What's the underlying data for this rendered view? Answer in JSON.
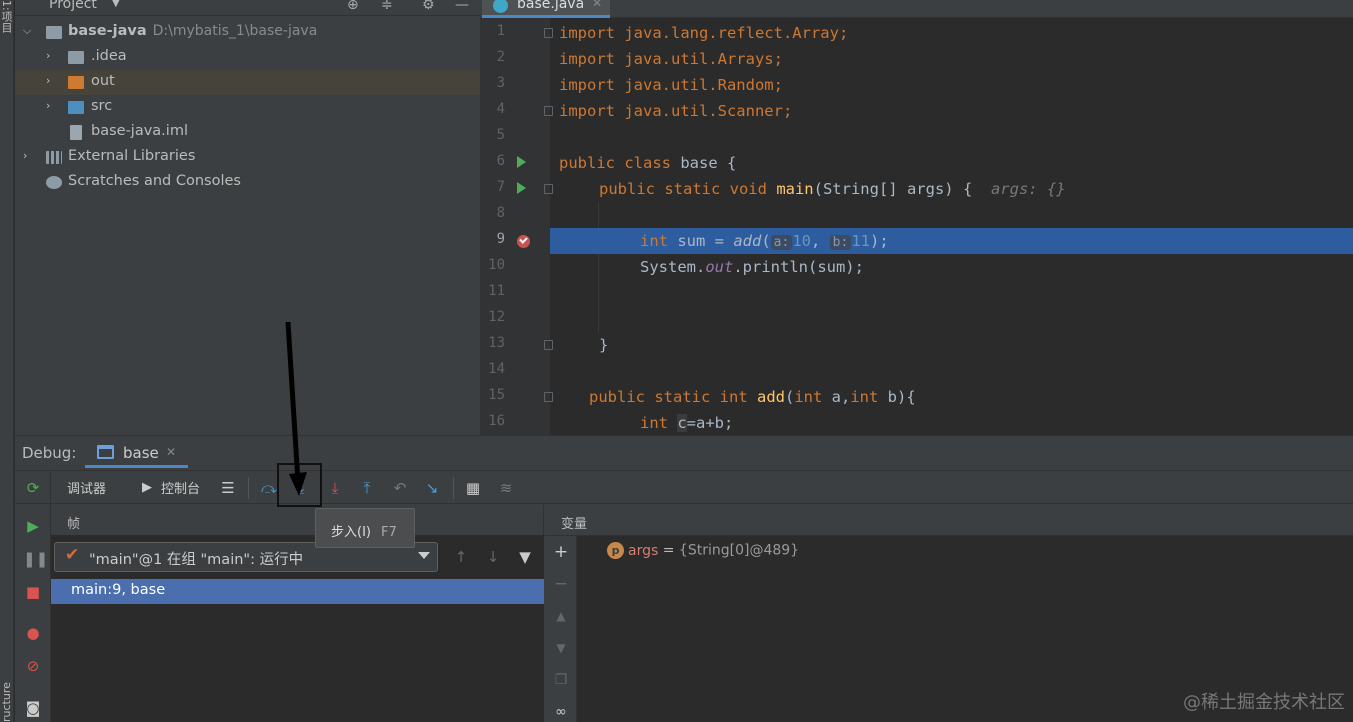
{
  "project_panel": {
    "title": "Project",
    "tree": [
      {
        "label": "base-java",
        "path": "D:\\mybatis_1\\base-java",
        "icon": "module-folder-icon",
        "expanded": true
      },
      {
        "label": ".idea",
        "icon": "folder-icon"
      },
      {
        "label": "out",
        "icon": "folder-orange-icon"
      },
      {
        "label": "src",
        "icon": "folder-blue-icon"
      },
      {
        "label": "base-java.iml",
        "icon": "iml-file-icon"
      },
      {
        "label": "External Libraries",
        "icon": "libraries-icon"
      },
      {
        "label": "Scratches and Consoles",
        "icon": "scratches-icon"
      }
    ]
  },
  "left_strip": {
    "top_label": "1:项目",
    "bottom_label": "ructure"
  },
  "editor": {
    "tab": "base.java",
    "lines": [
      "1",
      "2",
      "3",
      "4",
      "5",
      "6",
      "7",
      "8",
      "9",
      "10",
      "11",
      "12",
      "13",
      "14",
      "15",
      "16"
    ],
    "code": {
      "l1": "import java.lang.reflect.Array;",
      "l2": "import java.util.Arrays;",
      "l3": "import java.util.Random;",
      "l4": "import java.util.Scanner;",
      "l6a": "public class ",
      "l6b": "base {",
      "l7a": "public static void ",
      "l7b": "main",
      "l7c": "(String[] args) {",
      "l7hint": "args: {}",
      "l9a": "int ",
      "l9b": "sum = ",
      "l9c": "add",
      "l9d": "(",
      "l9ha": "a:",
      "l9v1": "10",
      "l9comma": ", ",
      "l9hb": "b:",
      "l9v2": "11",
      "l9e": ");",
      "l10a": "System.",
      "l10b": "out",
      "l10c": ".println(sum);",
      "l13": "}",
      "l15a": "public static int ",
      "l15b": "add",
      "l15c": "(",
      "l15d": "int ",
      "l15e": "a,",
      "l15f": "int ",
      "l15g": "b){",
      "l16a": "int ",
      "l16b": "c",
      "l16c": "=a+b;"
    }
  },
  "debug": {
    "title": "Debug:",
    "session_tab": "base",
    "tabs": {
      "debugger": "调试器",
      "console": "控制台"
    },
    "frames_title": "帧",
    "thread": "\"main\"@1 在组 \"main\": 运行中",
    "frame_row": "main:9, base",
    "variables_title": "变量",
    "variable": {
      "badge": "p",
      "name": "args",
      "eq": " = ",
      "value": "{String[0]@489}"
    },
    "tooltip": {
      "label": "步入(I)",
      "shortcut": "F7"
    }
  },
  "watermark": "@稀土掘金技术社区",
  "colors": {
    "accent": "#4a88c7",
    "selection": "#2d5d9f",
    "frame_selected": "#4b6eaf",
    "breakpoint": "#c75450",
    "keyword": "#cc7832"
  }
}
